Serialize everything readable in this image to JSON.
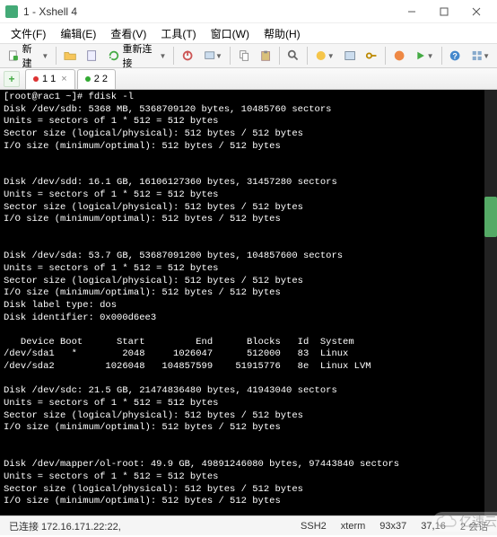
{
  "window": {
    "title": "1 - Xshell 4"
  },
  "menu": {
    "file": "文件(F)",
    "edit": "编辑(E)",
    "view": "查看(V)",
    "tools": "工具(T)",
    "window": "窗口(W)",
    "help": "帮助(H)"
  },
  "toolbar": {
    "new_label": "新建",
    "reconnect_label": "重新连接"
  },
  "tabs": [
    {
      "label": "1 1",
      "dot": "#d33"
    },
    {
      "label": "2 2",
      "dot": "#3a3"
    }
  ],
  "terminal": {
    "prompt": "[root@rac1 ~]# fdisk -l",
    "body": "\nDisk /dev/sdb: 5368 MB, 5368709120 bytes, 10485760 sectors\nUnits = sectors of 1 * 512 = 512 bytes\nSector size (logical/physical): 512 bytes / 512 bytes\nI/O size (minimum/optimal): 512 bytes / 512 bytes\n\n\nDisk /dev/sdd: 16.1 GB, 16106127360 bytes, 31457280 sectors\nUnits = sectors of 1 * 512 = 512 bytes\nSector size (logical/physical): 512 bytes / 512 bytes\nI/O size (minimum/optimal): 512 bytes / 512 bytes\n\n\nDisk /dev/sda: 53.7 GB, 53687091200 bytes, 104857600 sectors\nUnits = sectors of 1 * 512 = 512 bytes\nSector size (logical/physical): 512 bytes / 512 bytes\nI/O size (minimum/optimal): 512 bytes / 512 bytes\nDisk label type: dos\nDisk identifier: 0x000d6ee3\n\n   Device Boot      Start         End      Blocks   Id  System\n/dev/sda1   *        2048     1026047      512000   83  Linux\n/dev/sda2         1026048   104857599    51915776   8e  Linux LVM\n\nDisk /dev/sdc: 21.5 GB, 21474836480 bytes, 41943040 sectors\nUnits = sectors of 1 * 512 = 512 bytes\nSector size (logical/physical): 512 bytes / 512 bytes\nI/O size (minimum/optimal): 512 bytes / 512 bytes\n\n\nDisk /dev/mapper/ol-root: 49.9 GB, 49891246080 bytes, 97443840 sectors\nUnits = sectors of 1 * 512 = 512 bytes\nSector size (logical/physical): 512 bytes / 512 bytes\nI/O size (minimum/optimal): 512 bytes / 512 bytes"
  },
  "status": {
    "left": "已连接  172.16.171.22:22,",
    "ssh": "SSH2",
    "term": "xterm",
    "size": "93x37",
    "cursor": "37,16",
    "sessions": "2 会话"
  },
  "watermark": "亿速云"
}
